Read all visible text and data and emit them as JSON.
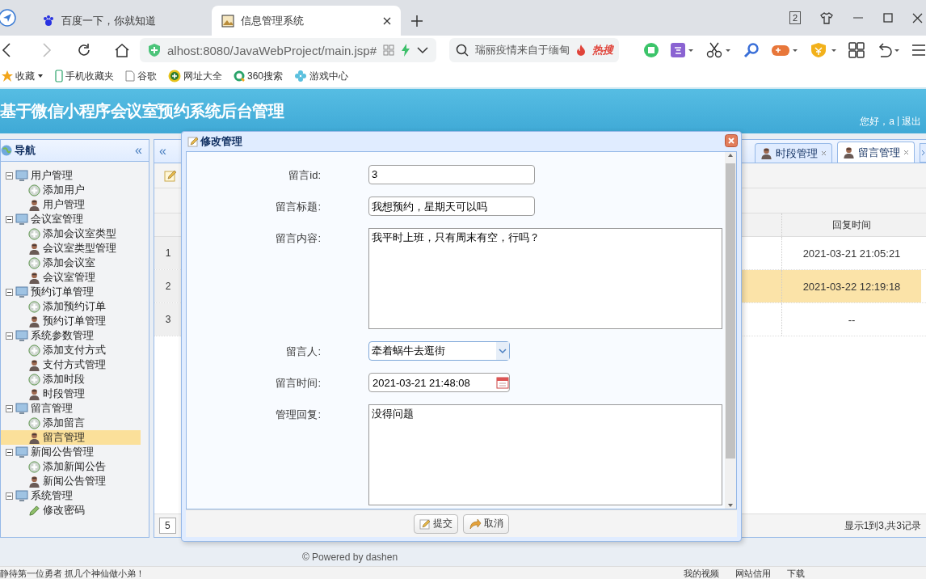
{
  "browser": {
    "tabs": [
      {
        "title": "百度一下，你就知道",
        "selected": false
      },
      {
        "title": "信息管理系统",
        "selected": true
      }
    ],
    "tab_count": "2",
    "address": "alhost:8080/JavaWebProject/main.jsp#",
    "search": {
      "value": "瑞丽疫情来自于缅甸",
      "badge": "热搜"
    },
    "bookmarks": [
      "收藏",
      "手机收藏夹",
      "谷歌",
      "网址大全",
      "360搜索",
      "游戏中心"
    ]
  },
  "header": {
    "title": "基于微信小程序会议室预约系统后台管理",
    "greeting": "您好，a",
    "separator": "|",
    "logout": "退出"
  },
  "nav": {
    "title": "导航",
    "collapse": "«",
    "groups": [
      {
        "label": "用户管理",
        "expanded": true,
        "children": [
          {
            "label": "添加用户",
            "kind": "add",
            "selected": false
          },
          {
            "label": "用户管理",
            "kind": "manage",
            "selected": false
          }
        ]
      },
      {
        "label": "会议室管理",
        "expanded": true,
        "children": [
          {
            "label": "添加会议室类型",
            "kind": "add",
            "selected": false
          },
          {
            "label": "会议室类型管理",
            "kind": "manage",
            "selected": false
          },
          {
            "label": "添加会议室",
            "kind": "add",
            "selected": false
          },
          {
            "label": "会议室管理",
            "kind": "manage",
            "selected": false
          }
        ]
      },
      {
        "label": "预约订单管理",
        "expanded": true,
        "children": [
          {
            "label": "添加预约订单",
            "kind": "add",
            "selected": false
          },
          {
            "label": "预约订单管理",
            "kind": "manage",
            "selected": false
          }
        ]
      },
      {
        "label": "系统参数管理",
        "expanded": true,
        "children": [
          {
            "label": "添加支付方式",
            "kind": "add",
            "selected": false
          },
          {
            "label": "支付方式管理",
            "kind": "manage",
            "selected": false
          },
          {
            "label": "添加时段",
            "kind": "add",
            "selected": false
          },
          {
            "label": "时段管理",
            "kind": "manage",
            "selected": false
          }
        ]
      },
      {
        "label": "留言管理",
        "expanded": true,
        "children": [
          {
            "label": "添加留言",
            "kind": "add",
            "selected": false
          },
          {
            "label": "留言管理",
            "kind": "manage",
            "selected": true
          }
        ]
      },
      {
        "label": "新闻公告管理",
        "expanded": true,
        "children": [
          {
            "label": "添加新闻公告",
            "kind": "add",
            "selected": false
          },
          {
            "label": "新闻公告管理",
            "kind": "manage",
            "selected": false
          }
        ]
      },
      {
        "label": "系统管理",
        "expanded": true,
        "children": [
          {
            "label": "修改密码",
            "kind": "edit",
            "selected": false
          }
        ]
      }
    ]
  },
  "tabs": {
    "scroll_left": "«",
    "items": [
      {
        "label": "时段管理",
        "selected": false
      },
      {
        "label": "留言管理",
        "selected": true
      }
    ]
  },
  "table": {
    "columns": [
      "回复时间"
    ],
    "rows": [
      {
        "number": "1",
        "reply_time": "2021-03-21 21:05:21",
        "selected": false
      },
      {
        "number": "2",
        "reply_time": "2021-03-22 12:19:18",
        "selected": true
      },
      {
        "number": "3",
        "reply_time": "--",
        "selected": false
      }
    ]
  },
  "pager": {
    "page_size": "5",
    "summary": "显示1到3,共3记录"
  },
  "dialog": {
    "title": "修改管理",
    "fields": [
      {
        "label": "留言id:",
        "kind": "text",
        "value": "3"
      },
      {
        "label": "留言标题:",
        "kind": "text",
        "value": "我想预约，星期天可以吗"
      },
      {
        "label": "留言内容:",
        "kind": "textarea",
        "value": "我平时上班，只有周末有空，行吗？"
      },
      {
        "label": "留言人:",
        "kind": "select",
        "value": "牵着蜗牛去逛街"
      },
      {
        "label": "留言时间:",
        "kind": "date",
        "value": "2021-03-21 21:48:08"
      },
      {
        "label": "管理回复:",
        "kind": "textarea",
        "value": "没得问题"
      }
    ],
    "buttons": [
      {
        "label": "提交",
        "kind": "submit"
      },
      {
        "label": "取消",
        "kind": "cancel"
      }
    ]
  },
  "footer": "© Powered by dashen",
  "status_bar": {
    "message": "静待第一位勇者 抓几个神仙做小弟！",
    "items": [
      "我的视频",
      "网站信用",
      "下载"
    ]
  }
}
